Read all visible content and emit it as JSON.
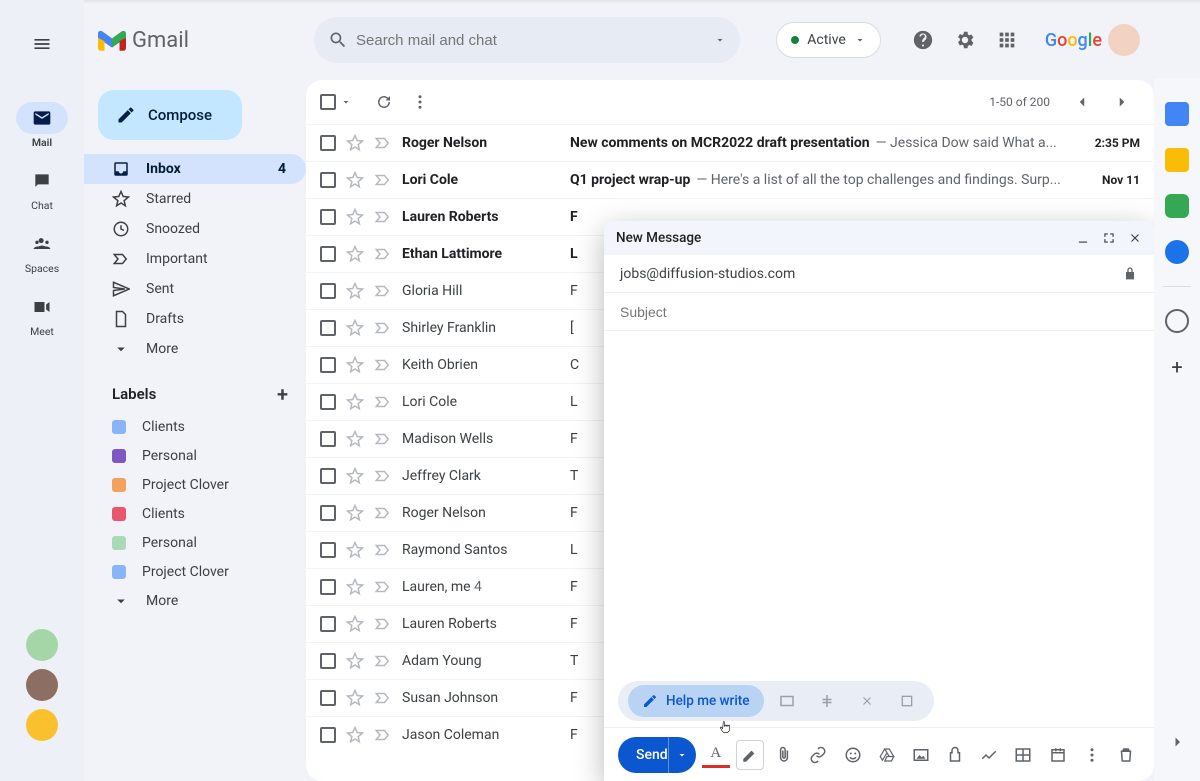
{
  "header": {
    "product": "Gmail",
    "search_placeholder": "Search mail and chat",
    "status_chip": "Active",
    "google_logo": [
      "G",
      "o",
      "o",
      "g",
      "l",
      "e"
    ]
  },
  "rail": {
    "items": [
      {
        "label": "Mail",
        "active": true
      },
      {
        "label": "Chat",
        "active": false
      },
      {
        "label": "Spaces",
        "active": false
      },
      {
        "label": "Meet",
        "active": false
      }
    ]
  },
  "sidebar": {
    "compose_label": "Compose",
    "nav": [
      {
        "label": "Inbox",
        "icon": "inbox",
        "active": true,
        "count": "4"
      },
      {
        "label": "Starred",
        "icon": "star"
      },
      {
        "label": "Snoozed",
        "icon": "clock"
      },
      {
        "label": "Important",
        "icon": "important"
      },
      {
        "label": "Sent",
        "icon": "send"
      },
      {
        "label": "Drafts",
        "icon": "draft"
      },
      {
        "label": "More",
        "icon": "chevron"
      }
    ],
    "labels_head": "Labels",
    "labels": [
      {
        "name": "Clients",
        "color": "#8ab4f8"
      },
      {
        "name": "Personal",
        "color": "#7e57c2"
      },
      {
        "name": "Project Clover",
        "color": "#f2a25c"
      },
      {
        "name": "Clients",
        "color": "#e8576e"
      },
      {
        "name": "Personal",
        "color": "#a8dab5"
      },
      {
        "name": "Project Clover",
        "color": "#8ab4f8"
      },
      {
        "name": "More",
        "icon": "chevron",
        "color": ""
      }
    ]
  },
  "list": {
    "pager": "1-50 of 200",
    "rows": [
      {
        "sender": "Roger Nelson",
        "unread": true,
        "subject": "New comments on MCR2022 draft presentation",
        "snippet": " — Jessica Dow said What a...",
        "time": "2:35 PM"
      },
      {
        "sender": "Lori Cole",
        "unread": true,
        "subject": "Q1 project wrap-up",
        "snippet": " — Here's a list of all the top challenges and findings. Surp...",
        "time": "Nov 11"
      },
      {
        "sender": "Lauren Roberts",
        "unread": true,
        "subject": "F",
        "snippet": "",
        "time": ""
      },
      {
        "sender": "Ethan Lattimore",
        "unread": true,
        "subject": "L",
        "snippet": "",
        "time": ""
      },
      {
        "sender": "Gloria Hill",
        "unread": false,
        "subject": "F",
        "snippet": "",
        "time": ""
      },
      {
        "sender": "Shirley Franklin",
        "unread": false,
        "subject": "[",
        "snippet": "",
        "time": ""
      },
      {
        "sender": "Keith Obrien",
        "unread": false,
        "subject": "C",
        "snippet": "",
        "time": ""
      },
      {
        "sender": "Lori Cole",
        "unread": false,
        "subject": "L",
        "snippet": "",
        "time": ""
      },
      {
        "sender": "Madison Wells",
        "unread": false,
        "subject": "F",
        "snippet": "",
        "time": ""
      },
      {
        "sender": "Jeffrey Clark",
        "unread": false,
        "subject": "T",
        "snippet": "",
        "time": ""
      },
      {
        "sender": "Roger Nelson",
        "unread": false,
        "subject": "F",
        "snippet": "",
        "time": ""
      },
      {
        "sender": "Raymond Santos",
        "unread": false,
        "subject": "L",
        "snippet": "",
        "time": ""
      },
      {
        "sender": "Lauren, me",
        "count": "4",
        "unread": false,
        "subject": "F",
        "snippet": "",
        "time": ""
      },
      {
        "sender": "Lauren Roberts",
        "unread": false,
        "subject": "F",
        "snippet": "",
        "time": ""
      },
      {
        "sender": "Adam Young",
        "unread": false,
        "subject": "T",
        "snippet": "",
        "time": ""
      },
      {
        "sender": "Susan Johnson",
        "unread": false,
        "subject": "F",
        "snippet": "",
        "time": ""
      },
      {
        "sender": "Jason Coleman",
        "unread": false,
        "subject": "F",
        "snippet": "",
        "time": ""
      }
    ]
  },
  "compose": {
    "title": "New Message",
    "to": "jobs@diffusion-studios.com",
    "subject_placeholder": "Subject",
    "help_me_write": "Help me write",
    "send_label": "Send"
  },
  "avatars": {
    "a0": "#a5d6a7",
    "a1": "#a1887f",
    "a2": "#fbc02d"
  }
}
